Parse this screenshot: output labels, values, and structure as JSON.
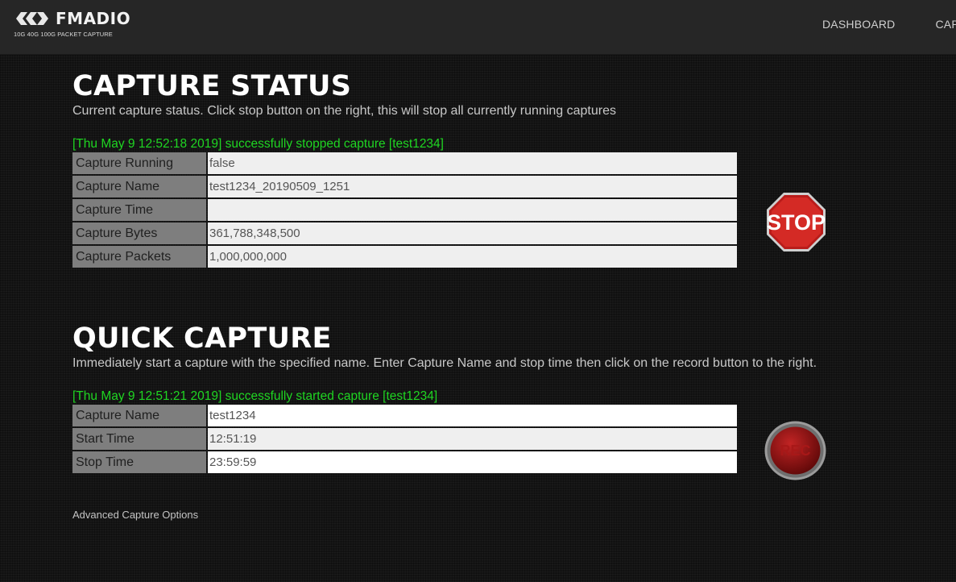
{
  "brand": {
    "name": "FMADIO",
    "tagline": "10G 40G 100G  PACKET CAPTURE"
  },
  "nav": {
    "items": [
      {
        "label": "DASHBOARD"
      },
      {
        "label": "CAPTURE"
      }
    ]
  },
  "capture_status": {
    "title": "CAPTURE STATUS",
    "description": "Current capture status. Click stop button on the right, this will stop all currently running captures",
    "message": "[Thu May 9 12:52:18 2019] successfully stopped capture [test1234]",
    "rows": [
      {
        "label": "Capture Running",
        "value": "false"
      },
      {
        "label": "Capture Name",
        "value": "test1234_20190509_1251"
      },
      {
        "label": "Capture Time",
        "value": ""
      },
      {
        "label": "Capture Bytes",
        "value": "361,788,348,500"
      },
      {
        "label": "Capture Packets",
        "value": "1,000,000,000"
      }
    ],
    "stop_button_label": "STOP"
  },
  "quick_capture": {
    "title": "QUICK CAPTURE",
    "description": "Immediately start a capture with the specified name. Enter Capture Name and stop time then click on the record button to the right.",
    "message": "[Thu May 9 12:51:21 2019] successfully started capture [test1234]",
    "rows": [
      {
        "label": "Capture Name",
        "value": "test1234"
      },
      {
        "label": "Start Time",
        "value": "12:51:19"
      },
      {
        "label": "Stop Time",
        "value": "23:59:59"
      }
    ],
    "rec_button_label": "REC",
    "advanced_link": "Advanced Capture Options"
  },
  "colors": {
    "success": "#1fd622",
    "stop_red": "#c8201e",
    "rec_red": "#8a1010",
    "label_bg": "#7e7e7e"
  }
}
